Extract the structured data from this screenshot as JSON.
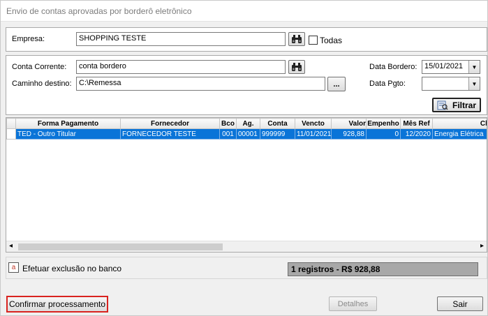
{
  "window": {
    "title": "Envio de contas aprovadas por borderô eletrônico"
  },
  "empresa": {
    "label": "Empresa:",
    "value": "SHOPPING TESTE",
    "todas_label": "Todas"
  },
  "conta": {
    "conta_label": "Conta Corrente:",
    "conta_value": "conta bordero",
    "caminho_label": "Caminho destino:",
    "caminho_value": "C:\\Remessa",
    "browse_label": "...",
    "data_bordero_label": "Data Bordero:",
    "data_bordero_value": "15/01/2021",
    "data_pgto_label": "Data Pgto:",
    "data_pgto_value": "",
    "filtrar_label": "Filtrar"
  },
  "grid": {
    "columns": [
      "Forma Pagamento",
      "Fornecedor",
      "Bco",
      "Ag.",
      "Conta",
      "Vencto",
      "Valor",
      "Empenho",
      "Mês Ref",
      "Clas"
    ],
    "rows": [
      [
        "TED - Outro Titular",
        "FORNECEDOR TESTE",
        "001",
        "00001",
        "999999",
        "11/01/2021",
        "928,88",
        "0",
        "12/2020",
        "Energia Elétrica"
      ]
    ]
  },
  "footer": {
    "checkbox_label": "Efetuar exclusão no banco",
    "status_text": "1 registros - R$ 928,88",
    "confirmar_label": "Confirmar processamento",
    "detalhes_label": "Detalhes",
    "sair_label": "Sair"
  },
  "colors": {
    "selection": "#0a74d8",
    "highlight_border": "#d9231f",
    "checkbox_accent": "#c0392b"
  }
}
